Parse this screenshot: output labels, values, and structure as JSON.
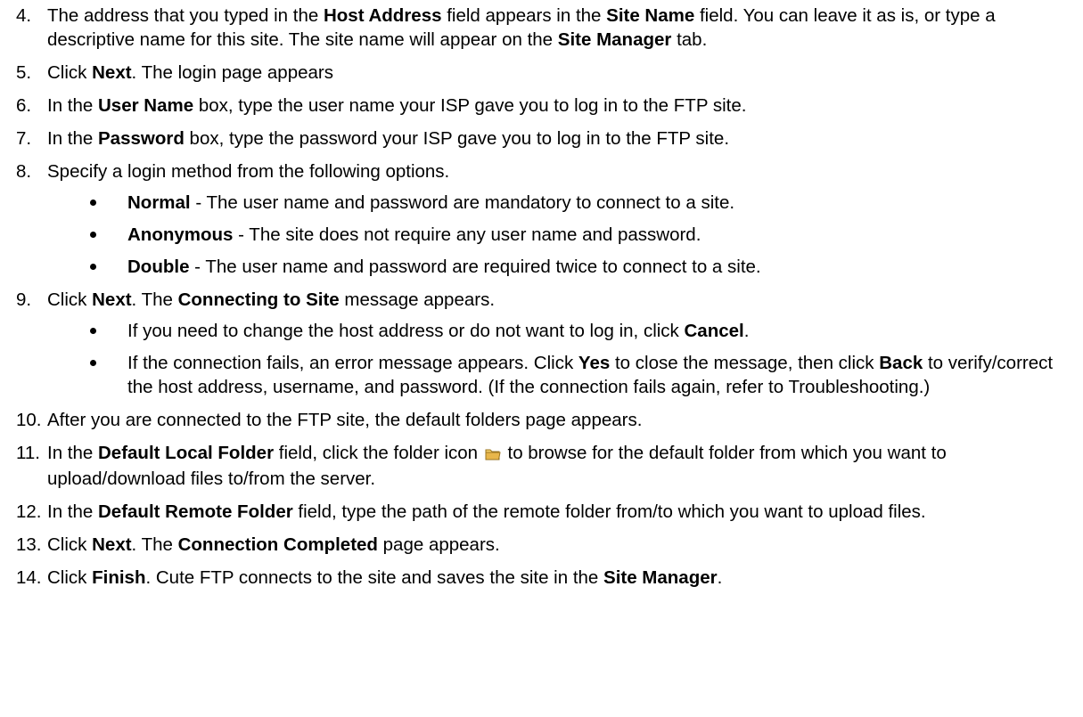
{
  "steps": [
    {
      "num": "4.",
      "parts": [
        "The address that you typed in the ",
        "Host Address",
        " field appears in the ",
        "Site Name",
        " field. You can leave it as is, or type a descriptive name for this site. The site name will appear on the ",
        "Site Manager",
        " tab."
      ]
    },
    {
      "num": "5.",
      "parts": [
        "Click ",
        "Next",
        ". The login page appears"
      ]
    },
    {
      "num": "6.",
      "parts": [
        "In the ",
        "User Name",
        " box, type the user name your ISP gave you to log in to the FTP site."
      ]
    },
    {
      "num": "7.",
      "parts": [
        "In the ",
        "Password",
        " box, type the password your ISP gave you to log in to the FTP site."
      ]
    },
    {
      "num": "8.",
      "parts": [
        "Specify a login method from the following options."
      ],
      "bullets": [
        {
          "parts": [
            "Normal",
            " - The user name and password are mandatory to connect to a site."
          ]
        },
        {
          "parts": [
            "Anonymous",
            " - The site does not require any user name and password."
          ]
        },
        {
          "parts": [
            "Double",
            " - The user name and password are required twice to connect to a site."
          ]
        }
      ]
    },
    {
      "num": "9.",
      "parts": [
        "Click ",
        "Next",
        ". The ",
        "Connecting to Site",
        " message appears."
      ],
      "bullets": [
        {
          "parts": [
            "If you need to change the host address or do not want to log in, click ",
            "Cancel",
            "."
          ]
        },
        {
          "parts": [
            "If the connection fails, an error message appears. Click ",
            "Yes",
            " to close the message, then click ",
            "Back",
            " to verify/correct the host address, username, and password. (If the connection fails again, refer to Troubleshooting.)"
          ]
        }
      ]
    },
    {
      "num": "10.",
      "parts": [
        "After you are connected to the FTP site, the default folders page appears."
      ]
    },
    {
      "num": "11.",
      "parts": [
        "In the ",
        "Default Local Folder",
        " field, click the folder icon ",
        " to browse for the default folder from which you want to upload/download files to/from the server."
      ]
    },
    {
      "num": "12.",
      "parts": [
        "In the ",
        "Default Remote Folder",
        " field, type the path of the remote folder from/to which you want to upload files."
      ]
    },
    {
      "num": "13.",
      "parts": [
        "Click ",
        "Next",
        ". The ",
        "Connection Completed",
        " page appears."
      ]
    },
    {
      "num": "14.",
      "parts": [
        "Click ",
        "Finish",
        ". Cute FTP connects to the site and saves the site in the ",
        "Site Manager",
        "."
      ]
    }
  ],
  "icons": {
    "folder": "folder-icon",
    "folder_color": "#e8b64a"
  }
}
